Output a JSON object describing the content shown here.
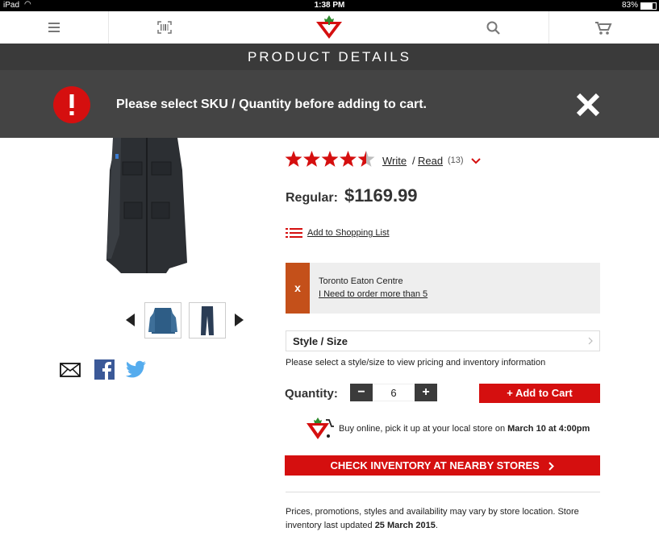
{
  "status_bar": {
    "device": "iPad",
    "time": "1:38 PM",
    "battery": "83%"
  },
  "header": {
    "title": "PRODUCT DETAILS"
  },
  "alert": {
    "message": "Please select SKU / Quantity before adding to cart."
  },
  "reviews": {
    "rating": 4.5,
    "write": "Write",
    "separator": "/",
    "read": "Read",
    "count": "(13)"
  },
  "price": {
    "label": "Regular:",
    "value": "$1169.99"
  },
  "shopping_list": {
    "label": "Add to Shopping List"
  },
  "store": {
    "remove": "x",
    "name": "Toronto Eaton Centre",
    "link": "I Need to order more than 5"
  },
  "style_size": {
    "label": "Style / Size",
    "hint": "Please select a style/size to view pricing and inventory information"
  },
  "quantity": {
    "label": "Quantity:",
    "minus": "−",
    "value": "6",
    "plus": "+"
  },
  "add_to_cart": {
    "label": "+ Add to Cart"
  },
  "pickup": {
    "text_prefix": "Buy online, pick it up at your local store on ",
    "date": "March 10 at 4:00pm"
  },
  "check_inventory": {
    "label": "CHECK INVENTORY AT NEARBY STORES"
  },
  "disclaimer": {
    "text": "Prices, promotions, styles and availability may vary by store location. Store inventory last updated ",
    "date": "25 March 2015",
    "end": "."
  },
  "colors": {
    "brand_red": "#d50f0f",
    "dark_bar": "#3a3a3a",
    "alert_bg": "#444444",
    "store_orange": "#c4501a"
  }
}
